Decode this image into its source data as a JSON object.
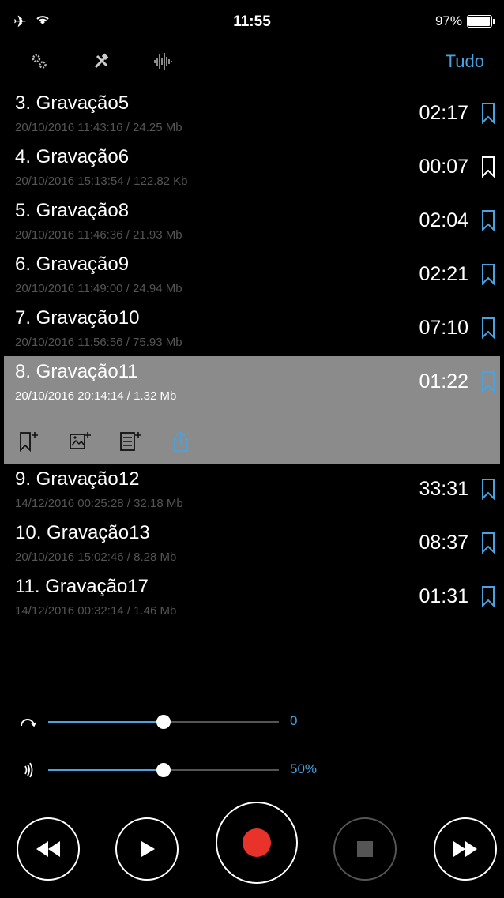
{
  "status": {
    "time": "11:55",
    "battery": "97%"
  },
  "toolbar": {
    "filter_label": "Tudo"
  },
  "recordings": [
    {
      "title": "3. Gravação5",
      "meta": "20/10/2016 11:43:16 / 24.25 Mb",
      "duration": "02:17",
      "bookmark": "blue"
    },
    {
      "title": "4. Gravação6",
      "meta": "20/10/2016 15:13:54 / 122.82 Kb",
      "duration": "00:07",
      "bookmark": "white"
    },
    {
      "title": "5. Gravação8",
      "meta": "20/10/2016 11:46:36 / 21.93 Mb",
      "duration": "02:04",
      "bookmark": "blue"
    },
    {
      "title": "6. Gravação9",
      "meta": "20/10/2016 11:49:00 / 24.94 Mb",
      "duration": "02:21",
      "bookmark": "blue"
    },
    {
      "title": "7. Gravação10",
      "meta": "20/10/2016 11:56:56 / 75.93 Mb",
      "duration": "07:10",
      "bookmark": "blue"
    },
    {
      "title": "8. Gravação11",
      "meta": "20/10/2016 20:14:14 / 1.32 Mb",
      "duration": "01:22",
      "bookmark": "blue",
      "selected": true
    },
    {
      "title": "9. Gravação12",
      "meta": "14/12/2016 00:25:28 / 32.18 Mb",
      "duration": "33:31",
      "bookmark": "blue"
    },
    {
      "title": "10. Gravação13",
      "meta": "20/10/2016 15:02:46 / 8.28 Mb",
      "duration": "08:37",
      "bookmark": "blue"
    },
    {
      "title": "11. Gravação17",
      "meta": "14/12/2016 00:32:14 / 1.46 Mb",
      "duration": "01:31",
      "bookmark": "blue"
    }
  ],
  "sliders": {
    "speed": {
      "value_label": "0",
      "level": 0.5
    },
    "volume": {
      "value_label": "50%",
      "level": 0.5
    }
  },
  "colors": {
    "accent": "#4aa3e0",
    "record": "#e8332a",
    "selected_row": "#8b8b8b"
  }
}
